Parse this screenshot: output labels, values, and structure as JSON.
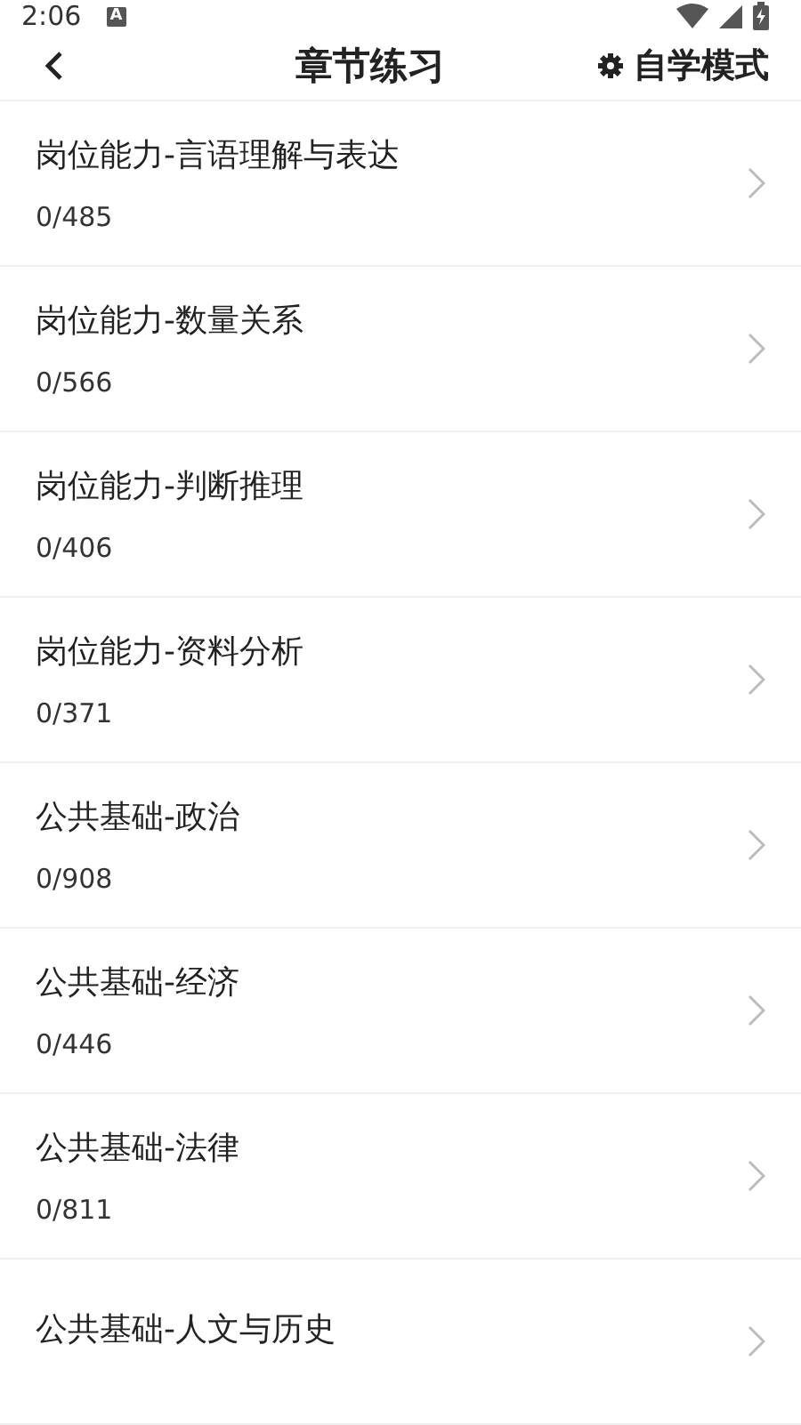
{
  "status_bar": {
    "time": "2:06",
    "notification": "A"
  },
  "toolbar": {
    "title": "章节练习",
    "action": "自学模式"
  },
  "chapters": [
    {
      "title": "岗位能力-言语理解与表达",
      "progress": "0/485"
    },
    {
      "title": "岗位能力-数量关系",
      "progress": "0/566"
    },
    {
      "title": "岗位能力-判断推理",
      "progress": "0/406"
    },
    {
      "title": "岗位能力-资料分析",
      "progress": "0/371"
    },
    {
      "title": "公共基础-政治",
      "progress": "0/908"
    },
    {
      "title": "公共基础-经济",
      "progress": "0/446"
    },
    {
      "title": "公共基础-法律",
      "progress": "0/811"
    },
    {
      "title": "公共基础-人文与历史"
    }
  ]
}
